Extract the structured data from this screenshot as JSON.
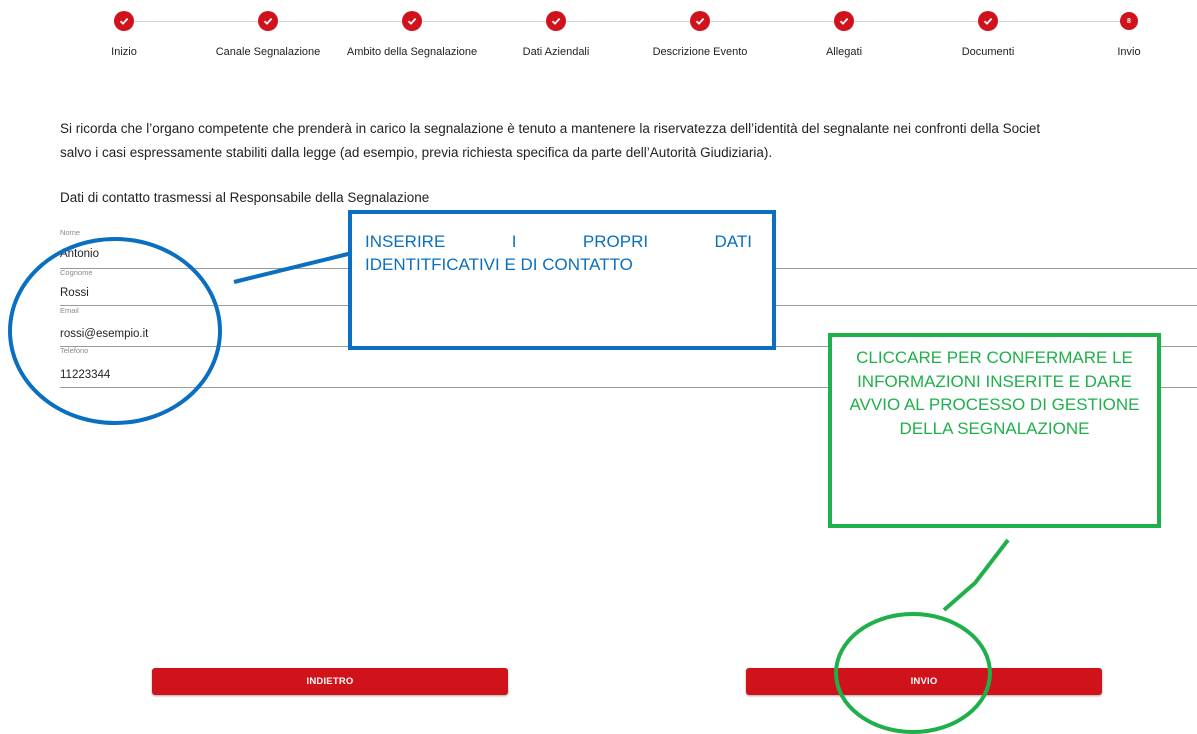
{
  "stepper": {
    "steps": [
      {
        "label": "Inizio",
        "status": "done"
      },
      {
        "label": "Canale Segnalazione",
        "status": "done"
      },
      {
        "label": "Ambito della Segnalazione",
        "status": "done"
      },
      {
        "label": "Dati Aziendali",
        "status": "done"
      },
      {
        "label": "Descrizione Evento",
        "status": "done"
      },
      {
        "label": "Allegati",
        "status": "done"
      },
      {
        "label": "Documenti",
        "status": "done"
      },
      {
        "label": "Invio",
        "status": "current",
        "number": "8"
      }
    ]
  },
  "notice": {
    "line1": "Si ricorda che l’organo competente che prenderà in carico la segnalazione è tenuto a mantenere la riservatezza dell’identità del segnalante nei confronti della Societ",
    "line2": "salvo i casi espressamente stabiliti dalla legge (ad esempio, previa richiesta specifica da parte dell’Autorità Giudiziaria)."
  },
  "contact": {
    "title": "Dati di contatto trasmessi al Responsabile della Segnalazione",
    "fields": [
      {
        "label": "Nome",
        "value": "Antonio"
      },
      {
        "label": "Cognome",
        "value": "Rossi"
      },
      {
        "label": "Email",
        "value": "rossi@esempio.it"
      },
      {
        "label": "Telefono",
        "value": "11223344"
      }
    ]
  },
  "buttons": {
    "back_label": "INDIETRO",
    "send_label": "INVIO"
  },
  "annotations": {
    "blue_callout": {
      "words": [
        "INSERIRE",
        "I",
        "PROPRI",
        "DATI"
      ],
      "line2": "IDENTITFICATIVI E DI CONTATTO"
    },
    "green_callout": "CLICCARE PER CONFERMARE LE INFORMAZIONI INSERITE E DARE AVVIO AL PROCESSO DI GESTIONE DELLA SEGNALAZIONE"
  },
  "colors": {
    "accent_red": "#d0121b",
    "annotation_blue": "#0a6fc0",
    "annotation_green": "#1fb04b"
  }
}
